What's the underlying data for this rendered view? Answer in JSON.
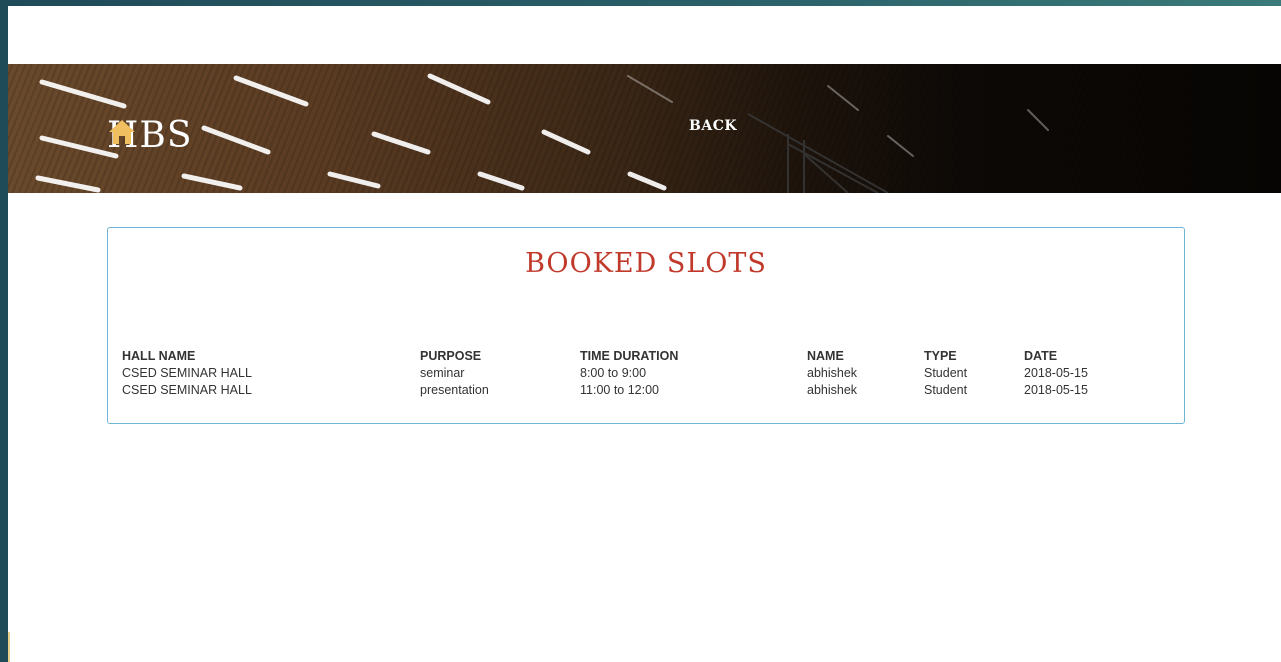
{
  "header": {
    "brand": "HBS",
    "brand_icon": "home-icon",
    "back_label": "BACK"
  },
  "panel": {
    "title": "BOOKED SLOTS"
  },
  "table": {
    "columns": [
      "HALL NAME",
      "PURPOSE",
      "TIME DURATION",
      "NAME",
      "TYPE",
      "DATE"
    ],
    "rows": [
      [
        "CSED SEMINAR HALL",
        "seminar",
        "8:00 to 9:00",
        "abhishek",
        "Student",
        "2018-05-15"
      ],
      [
        "CSED SEMINAR HALL",
        "presentation",
        "11:00 to 12:00",
        "abhishek",
        "Student",
        "2018-05-15"
      ]
    ]
  },
  "colors": {
    "title_red": "#c0392b",
    "panel_border": "#6fb4d6",
    "icon_gold": "#f0c060"
  }
}
